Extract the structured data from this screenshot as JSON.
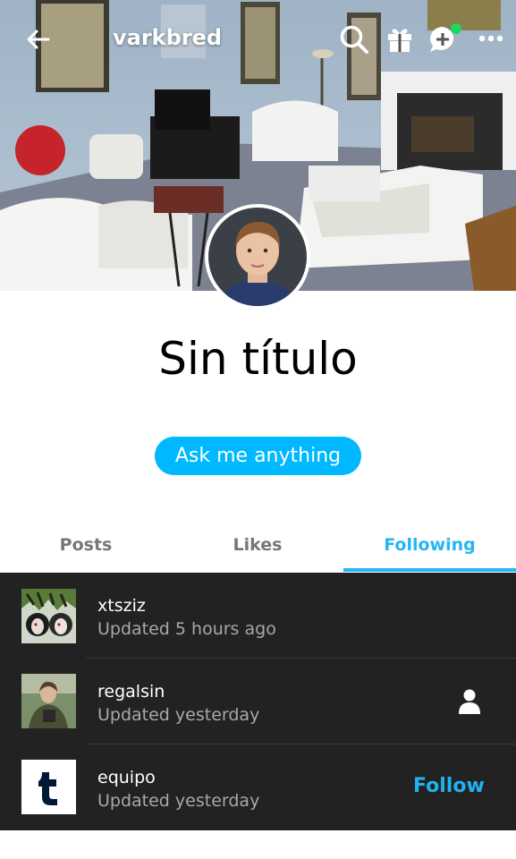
{
  "header": {
    "blog_name": "varkbred",
    "cover_image": "living-room-photo"
  },
  "topbar": {
    "back_icon": "arrow-left-icon",
    "search_icon": "search-icon",
    "gift_icon": "gift-icon",
    "new_post_icon": "chat-plus-icon",
    "more_icon": "more-horizontal-icon"
  },
  "profile": {
    "title": "Sin título",
    "ask_label": "Ask me anything"
  },
  "tabs": [
    {
      "label": "Posts",
      "active": false
    },
    {
      "label": "Likes",
      "active": false
    },
    {
      "label": "Following",
      "active": true
    }
  ],
  "following": [
    {
      "name": "xtsziz",
      "updated": "Updated 5 hours ago",
      "action": ""
    },
    {
      "name": "regalsin",
      "updated": "Updated yesterday",
      "action": "person-icon"
    },
    {
      "name": "equipo",
      "updated": "Updated yesterday",
      "action": "Follow"
    }
  ],
  "colors": {
    "accent": "#00b8ff",
    "tab_active": "#25b7f2",
    "list_bg": "#222222",
    "notification_dot": "#1ed760"
  }
}
